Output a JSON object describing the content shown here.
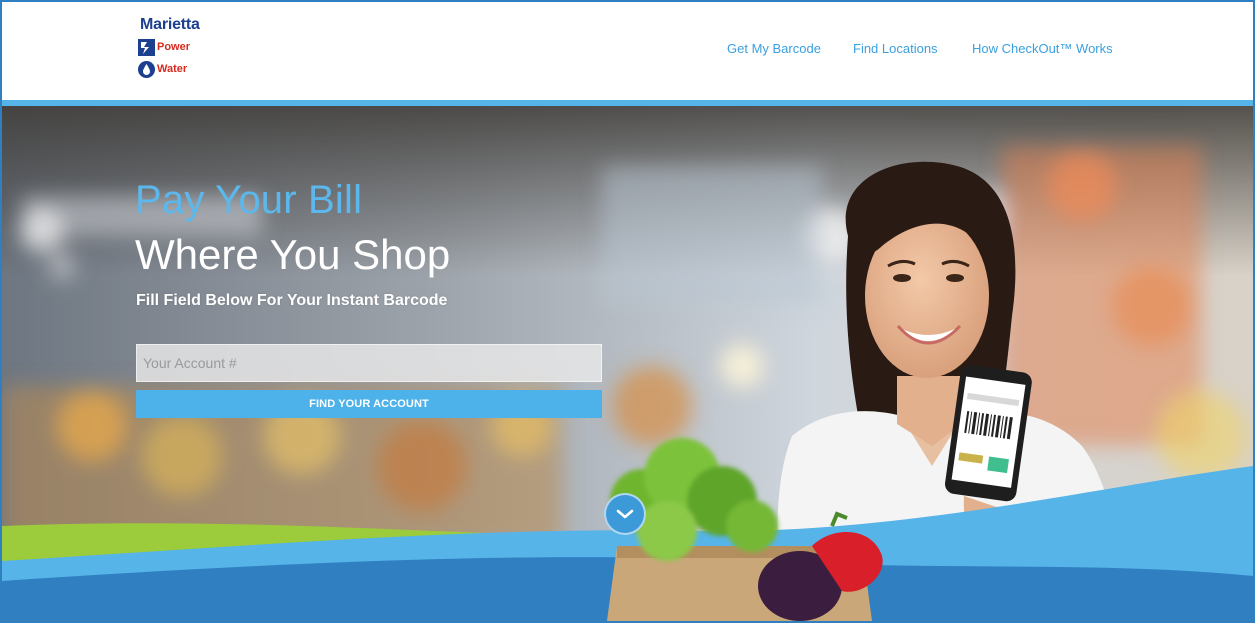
{
  "brand": {
    "name_line1": "Marietta",
    "name_line2": "Power",
    "name_line3": "Water",
    "colors": {
      "navy": "#1c3f8f",
      "red": "#d62b1f"
    }
  },
  "nav": {
    "items": [
      {
        "label": "Get My Barcode"
      },
      {
        "label": "Find Locations"
      },
      {
        "label": "How CheckOut™ Works"
      }
    ]
  },
  "hero": {
    "headline_line1": "Pay Your Bill",
    "headline_line2": "Where You Shop",
    "subheadline": "Fill Field Below For Your Instant Barcode",
    "account_input": {
      "placeholder": "Your Account #",
      "value": ""
    },
    "submit_label": "FIND YOUR ACCOUNT",
    "scroll_icon": "chevron-down-icon"
  },
  "colors": {
    "accent_blue": "#4eb2ea",
    "headline_blue": "#5cb8ec",
    "wave_dark_blue": "#2f7fc1",
    "wave_green": "#9ccb3b",
    "border_blue": "#2f7fc1"
  }
}
